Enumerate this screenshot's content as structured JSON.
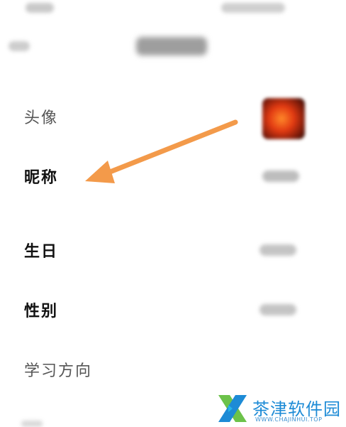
{
  "colors": {
    "arrow": "#f39a4a",
    "watermark": "#1d8bd6",
    "background": "#ffffff"
  },
  "icons": {
    "back": "back-arrow-icon",
    "annotation": "orange-arrow-annotation",
    "watermark_logo": "x-logo-icon"
  },
  "profile": {
    "rows": [
      {
        "label": "头像"
      },
      {
        "label": "昵称"
      },
      {
        "label": "生日"
      },
      {
        "label": "性别"
      },
      {
        "label": "学习方向"
      }
    ]
  },
  "watermark": {
    "name": "茶津软件园",
    "url": "WWW.CHAJINHUI.TOP"
  }
}
